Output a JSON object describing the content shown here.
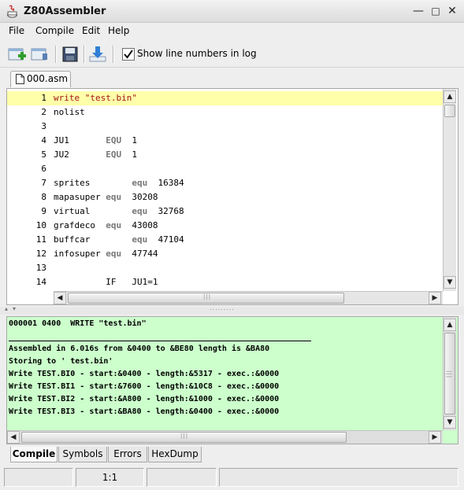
{
  "window": {
    "title": "Z80Assembler"
  },
  "menu": [
    "File",
    "Compile",
    "Edit",
    "Help"
  ],
  "toolbar": {
    "show_line_numbers_label": "Show line numbers in log",
    "show_line_numbers_checked": true
  },
  "tab": {
    "filename": "000.asm"
  },
  "editor": {
    "lines": [
      {
        "num": "1",
        "parts": [
          [
            "str",
            "write \"test.bin\""
          ]
        ]
      },
      {
        "num": "2",
        "parts": [
          [
            "",
            "nolist"
          ]
        ]
      },
      {
        "num": "3",
        "parts": []
      },
      {
        "num": "4",
        "parts": [
          [
            "",
            "JU1       "
          ],
          [
            "kw",
            "EQU"
          ],
          [
            "",
            "  1"
          ]
        ]
      },
      {
        "num": "5",
        "parts": [
          [
            "",
            "JU2       "
          ],
          [
            "kw",
            "EQU"
          ],
          [
            "",
            "  1"
          ]
        ]
      },
      {
        "num": "6",
        "parts": []
      },
      {
        "num": "7",
        "parts": [
          [
            "",
            "sprites        "
          ],
          [
            "kw",
            "equ"
          ],
          [
            "",
            "  16384"
          ]
        ]
      },
      {
        "num": "8",
        "parts": [
          [
            "",
            "mapasuper "
          ],
          [
            "kw",
            "equ"
          ],
          [
            "",
            "  30208"
          ]
        ]
      },
      {
        "num": "9",
        "parts": [
          [
            "",
            "virtual        "
          ],
          [
            "kw",
            "equ"
          ],
          [
            "",
            "  32768"
          ]
        ]
      },
      {
        "num": "10",
        "parts": [
          [
            "",
            "grafdeco  "
          ],
          [
            "kw",
            "equ"
          ],
          [
            "",
            "  43008"
          ]
        ]
      },
      {
        "num": "11",
        "parts": [
          [
            "",
            "buffcar        "
          ],
          [
            "kw",
            "equ"
          ],
          [
            "",
            "  47104"
          ]
        ]
      },
      {
        "num": "12",
        "parts": [
          [
            "",
            "infosuper "
          ],
          [
            "kw",
            "equ"
          ],
          [
            "",
            "  47744"
          ]
        ]
      },
      {
        "num": "13",
        "parts": []
      },
      {
        "num": "14",
        "parts": [
          [
            "",
            "          IF   JU1=1"
          ]
        ]
      }
    ]
  },
  "log": {
    "lines": [
      "000001 0400  WRITE \"test.bin\"",
      "",
      "Assembled in 6.016s from &0400 to &BE80 length is &BA80",
      "Storing to ' test.bin'",
      "Write TEST.BI0 - start:&0400 - length:&5317 - exec.:&0000",
      "Write TEST.BI1 - start:&7600 - length:&10C8 - exec.:&0000",
      "Write TEST.BI2 - start:&A800 - length:&1000 - exec.:&0000",
      "Write TEST.BI3 - start:&BA80 - length:&0400 - exec.:&0000"
    ]
  },
  "bottom_tabs": [
    "Compile",
    "Symbols",
    "Errors",
    "HexDump"
  ],
  "active_bottom_tab": "Compile",
  "status": {
    "cell1": "",
    "position": "1:1",
    "cell3": "",
    "cell4": ""
  }
}
